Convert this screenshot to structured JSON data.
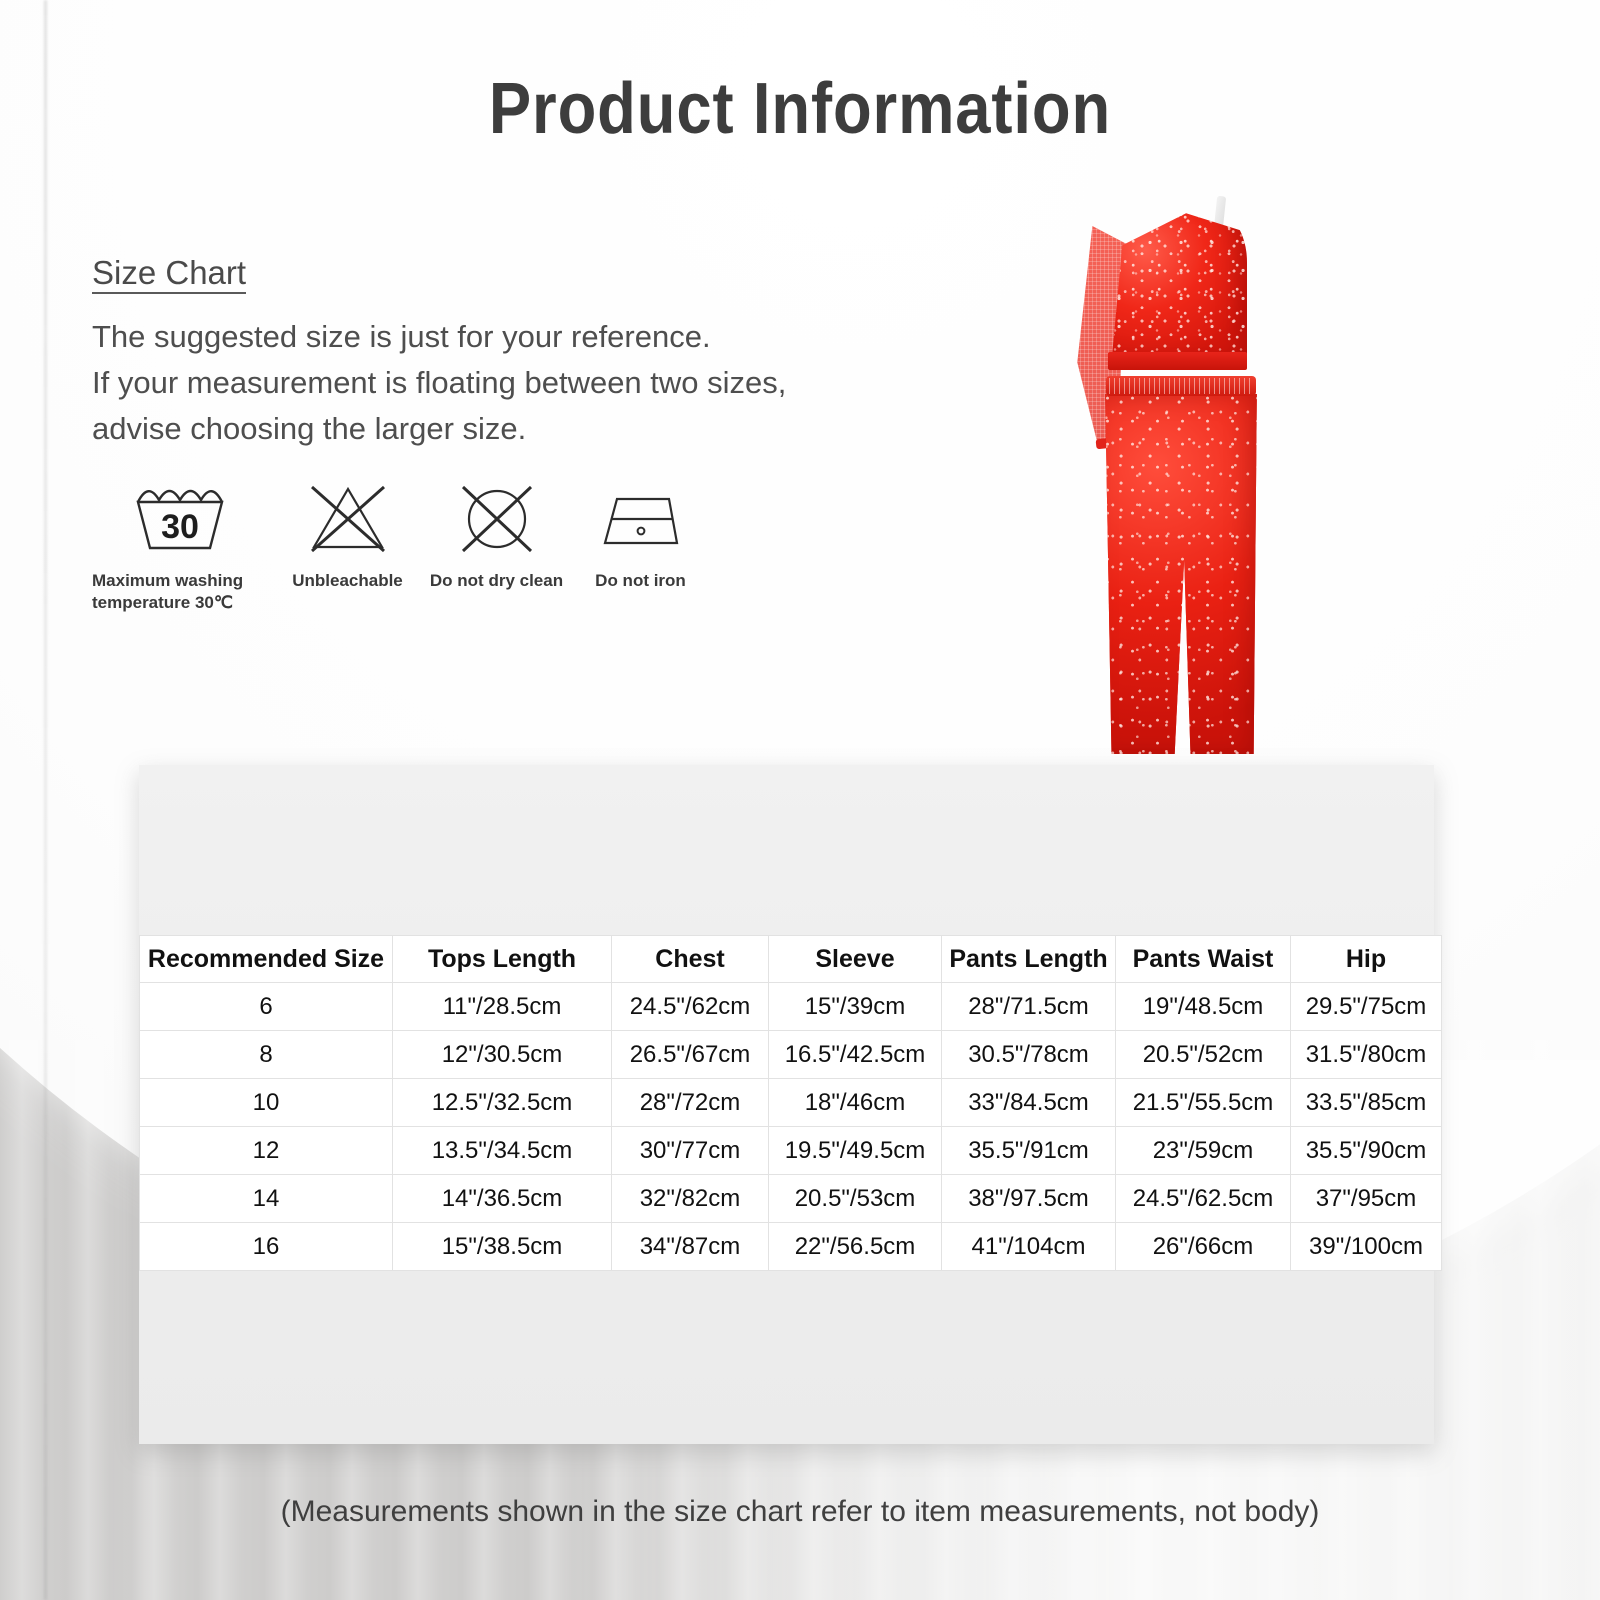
{
  "page": {
    "title": "Product  Information",
    "footnote": "(Measurements shown in the size chart refer to item measurements, not body)"
  },
  "size_chart_note": {
    "heading": "Size Chart",
    "line1": "The suggested size is just for your reference.",
    "line2": "If your measurement is floating between two sizes,",
    "line3": "advise choosing the larger size."
  },
  "care_icons": [
    {
      "icon": "wash-tub-30-icon",
      "label": "Maximum washing\ntemperature 30℃"
    },
    {
      "icon": "no-bleach-triangle-icon",
      "label": "Unbleachable"
    },
    {
      "icon": "no-dry-clean-circle-icon",
      "label": "Do not dry clean"
    },
    {
      "icon": "no-iron-icon",
      "label": "Do not iron"
    }
  ],
  "product_image": {
    "alt": "red-sequin-one-shoulder-crop-top-and-wide-leg-pants-set",
    "colors": {
      "sequin_red": "#e01c10",
      "mesh_red": "#f03c2d"
    }
  },
  "chart_data": {
    "type": "table",
    "title": "Size Chart",
    "columns": [
      "Recommended Size",
      "Tops Length",
      "Chest",
      "Sleeve",
      "Pants Length",
      "Pants Waist",
      "Hip"
    ],
    "rows": [
      [
        "6",
        "11\"/28.5cm",
        "24.5\"/62cm",
        "15\"/39cm",
        "28\"/71.5cm",
        "19\"/48.5cm",
        "29.5\"/75cm"
      ],
      [
        "8",
        "12\"/30.5cm",
        "26.5\"/67cm",
        "16.5\"/42.5cm",
        "30.5\"/78cm",
        "20.5\"/52cm",
        "31.5\"/80cm"
      ],
      [
        "10",
        "12.5\"/32.5cm",
        "28\"/72cm",
        "18\"/46cm",
        "33\"/84.5cm",
        "21.5\"/55.5cm",
        "33.5\"/85cm"
      ],
      [
        "12",
        "13.5\"/34.5cm",
        "30\"/77cm",
        "19.5\"/49.5cm",
        "35.5\"/91cm",
        "23\"/59cm",
        "35.5\"/90cm"
      ],
      [
        "14",
        "14\"/36.5cm",
        "32\"/82cm",
        "20.5\"/53cm",
        "38\"/97.5cm",
        "24.5\"/62.5cm",
        "37\"/95cm"
      ],
      [
        "16",
        "15\"/38.5cm",
        "34\"/87cm",
        "22\"/56.5cm",
        "41\"/104cm",
        "26\"/66cm",
        "39\"/100cm"
      ]
    ]
  },
  "colors": {
    "background": "#cdcccb",
    "panel": "#eeeeee",
    "title_text": "#3d3d3d",
    "body_text": "#4e4e4e",
    "table_text": "#111111",
    "table_border": "#e2e2e2"
  }
}
